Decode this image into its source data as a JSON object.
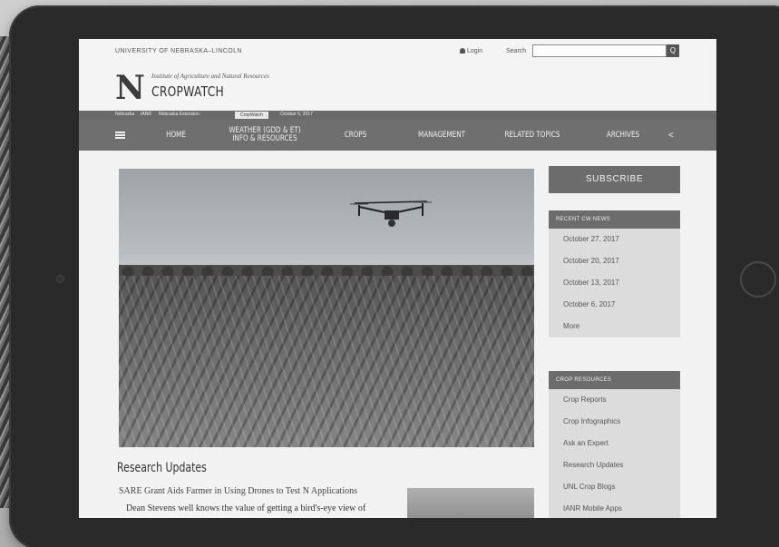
{
  "header": {
    "university": "UNIVERSITY OF NEBRASKA–LINCOLN",
    "login_label": "Login",
    "search_label": "Search",
    "search_value": "",
    "search_button": "Q",
    "logo_letter": "N",
    "institute": "Institute of Agriculture and Natural Resources",
    "site_title": "CROPWATCH"
  },
  "breadcrumbs": [
    "Nebraska",
    "IANR",
    "Nebraska Extension",
    "CropWatch",
    "October 6, 2017"
  ],
  "nav": {
    "items": [
      "HOME",
      "WEATHER (GDD & ET) INFO & RESOURCES",
      "CROPS",
      "MANAGEMENT",
      "RELATED TOPICS",
      "ARCHIVES"
    ]
  },
  "main": {
    "section_title": "Research Updates",
    "article_title": "SARE Grant Aids Farmer in Using Drones to Test N Applications",
    "article_excerpt": "Dean Stevens well knows the value of getting a bird's-eye view of"
  },
  "sidebar": {
    "subscribe_label": "SUBSCRIBE",
    "recent_heading": "RECENT CW NEWS",
    "recent_items": [
      "October 27, 2017",
      "October 20, 2017",
      "October 13, 2017",
      "October 6, 2017",
      "More"
    ],
    "resources_heading": "CROP RESOURCES",
    "resource_items": [
      "Crop Reports",
      "Crop Infographics",
      "Ask an Expert",
      "Research Updates",
      "UNL Crop Blogs",
      "IANR Mobile Apps"
    ]
  },
  "icons": {
    "menu": "hamburger-icon",
    "share": "share-icon",
    "user": "user-icon",
    "search": "search-icon"
  }
}
